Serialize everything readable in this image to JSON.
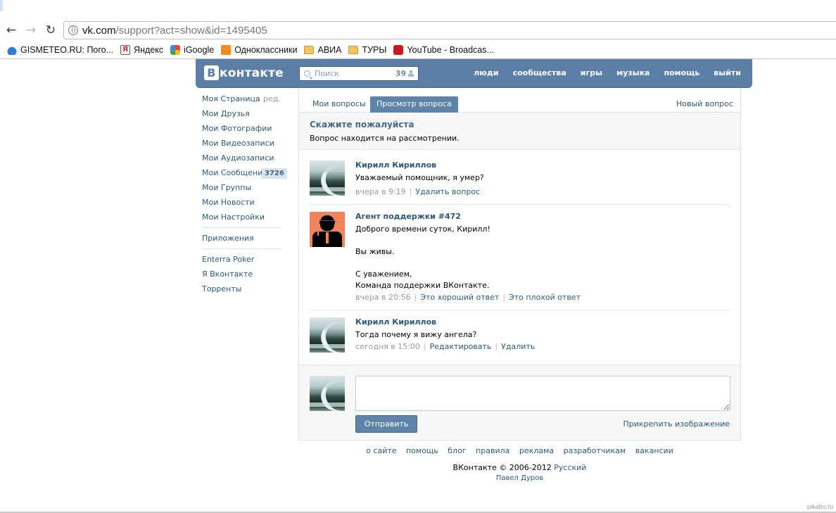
{
  "browser": {
    "url_host": "vk.com",
    "url_path": "/support?act=show&id=1495405",
    "bookmarks": [
      {
        "label": "GISMETEO.RU: Пого...",
        "icon": "water-drop-icon"
      },
      {
        "label": "Яндекс",
        "icon": "yandex-icon"
      },
      {
        "label": "iGoogle",
        "icon": "google-icon"
      },
      {
        "label": "Одноклассники",
        "icon": "odnoklassniki-icon"
      },
      {
        "label": "АВИА",
        "icon": "folder-icon"
      },
      {
        "label": "ТУРЫ",
        "icon": "folder-icon"
      },
      {
        "label": "YouTube - Broadcas...",
        "icon": "youtube-icon"
      }
    ]
  },
  "header": {
    "logo_letter": "В",
    "logo_text": "контакте",
    "search_placeholder": "Поиск",
    "search_count": "39",
    "menu": [
      "люди",
      "сообщества",
      "игры",
      "музыка",
      "помощь",
      "выйти"
    ]
  },
  "sidebar": {
    "edit_label": "ред.",
    "messages_badge": "3726",
    "items": [
      "Моя Страница",
      "Мои Друзья",
      "Мои Фотографии",
      "Мои Видеозаписи",
      "Мои Аудиозаписи",
      "Мои Сообщения",
      "Мои Группы",
      "Мои Новости",
      "Мои Настройки"
    ],
    "apps": "Приложения",
    "extra": [
      "Enterra Poker",
      "Я Вконтакте",
      "Торренты"
    ]
  },
  "tabs": {
    "my_questions": "Мои вопросы",
    "view_question": "Просмотр вопроса",
    "new_question": "Новый вопрос"
  },
  "question": {
    "title": "Скажите пожалуйста",
    "status": "Вопрос находится на рассмотрении."
  },
  "messages": [
    {
      "author": "Кирилл Кириллов",
      "lines": [
        "Уважаемый помощник, я умер?"
      ],
      "time": "вчера в 9:19",
      "actions": [
        "Удалить вопрос"
      ]
    },
    {
      "author": "Агент поддержки #472",
      "lines": [
        "Доброго времени суток, Кирилл!",
        "",
        "Вы живы.",
        "",
        "С уважением,",
        "Команда поддержки ВКонтакте."
      ],
      "time": "вчера в 20:56",
      "actions": [
        "Это хороший ответ",
        "Это плохой ответ"
      ]
    },
    {
      "author": "Кирилл Кириллов",
      "lines": [
        "Тогда почему я вижу ангела?"
      ],
      "time": "сегодня в 15:00",
      "actions": [
        "Редактировать",
        "Удалить"
      ]
    }
  ],
  "reply": {
    "send_label": "Отправить",
    "attach_label": "Прикрепить изображение"
  },
  "footer": {
    "links": [
      "о сайте",
      "помощь",
      "блог",
      "правила",
      "реклама",
      "разработчикам",
      "вакансии"
    ],
    "copyright": "ВКонтакте © 2006-2012",
    "language": "Русский",
    "author": "Павел Дуров"
  },
  "watermark": "pikabu.ru"
}
